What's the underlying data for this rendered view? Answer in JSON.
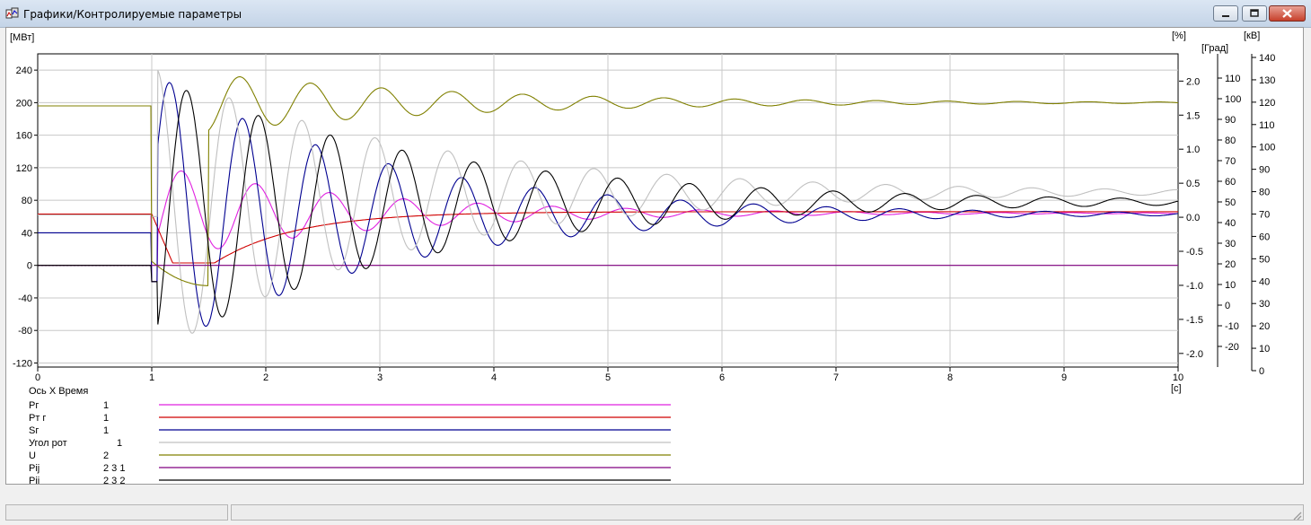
{
  "window": {
    "title": "Графики/Контролируемые параметры"
  },
  "chart_data": {
    "type": "line",
    "x": {
      "label": "[c]",
      "range": [
        0,
        10
      ],
      "ticks": [
        "0",
        "1",
        "2",
        "3",
        "4",
        "5",
        "6",
        "7",
        "8",
        "9",
        "10"
      ]
    },
    "axes": {
      "y_left": {
        "unit": "[МВт]",
        "range": [
          -125,
          260
        ],
        "ticks": [
          "240",
          "200",
          "160",
          "120",
          "80",
          "40",
          "0",
          "-40",
          "-80",
          "-120"
        ]
      },
      "y_right1": {
        "unit": "[%]",
        "range": [
          -2.2,
          2.4
        ],
        "ticks": [
          "2.0",
          "1.5",
          "1.0",
          "0.5",
          "0.0",
          "-0.5",
          "-1.0",
          "-1.5",
          "-2.0"
        ]
      },
      "y_right2": {
        "unit": "[Град]",
        "range": [
          -30,
          120
        ],
        "ticks": [
          "110",
          "100",
          "90",
          "80",
          "70",
          "60",
          "50",
          "40",
          "30",
          "20",
          "10",
          "0",
          "-10",
          "-20"
        ]
      },
      "y_right3": {
        "unit": "[кВ]",
        "range": [
          0,
          140
        ],
        "ticks": [
          "140",
          "130",
          "120",
          "110",
          "100",
          "90",
          "80",
          "70",
          "60",
          "50",
          "40",
          "30",
          "20",
          "10",
          "0"
        ]
      }
    },
    "grid": true,
    "zero_line": "dashed before t=1",
    "series": [
      {
        "name": "Pг",
        "axis": "y_left",
        "color": "#e020e0",
        "pre": 63,
        "post_start": -20,
        "final": 64,
        "amp": 60,
        "period": 0.65,
        "decay": 0.55,
        "phase": 0.1,
        "drift": 0
      },
      {
        "name": "Pт г",
        "axis": "y_left",
        "color": "#d00000",
        "pre": 63,
        "dip_to": 3,
        "dip_end": 1.55,
        "final": 66
      },
      {
        "name": "Sг",
        "axis": "y_left",
        "color": "#000090",
        "pre": 40,
        "post_start": -20,
        "final": 63,
        "amp": 175,
        "period": 0.64,
        "decay": 0.5,
        "phase": 0.0,
        "drift": 0
      },
      {
        "name": "Угол рот",
        "axis": "y_left",
        "color": "#c0c0c0",
        "pre": 62,
        "post_start": 60,
        "final": 90,
        "amp": 180,
        "period": 0.64,
        "decay": 0.45,
        "phase": -0.12,
        "drift": 25
      },
      {
        "name": "U",
        "axis": "y_left",
        "color": "#808000",
        "pre": 196,
        "dip_to": -25,
        "dip_end": 1.5,
        "final": 200,
        "amp": 45,
        "period": 0.62,
        "decay": 0.45
      },
      {
        "name": "Pij",
        "axis": "y_left",
        "color": "#800080",
        "pre": 0,
        "final": 0
      },
      {
        "name": "Pij",
        "axis": "y_left",
        "color": "#000000",
        "pre": 0,
        "post_start": -20,
        "final": 78,
        "amp": 170,
        "period": 0.63,
        "decay": 0.42,
        "phase": 0.15,
        "drift": 15
      }
    ]
  },
  "legend": {
    "header": "Ось X  Время",
    "items": [
      {
        "name": "Pг",
        "num": "1",
        "color": "#e020e0"
      },
      {
        "name": "Pт г",
        "num": "1",
        "color": "#d00000"
      },
      {
        "name": "Sг",
        "num": "1",
        "color": "#000090"
      },
      {
        "name": "Угол рот",
        "num": "1",
        "color": "#c0c0c0"
      },
      {
        "name": "U",
        "num": "2",
        "color": "#808000"
      },
      {
        "name": "Pij",
        "num": "2  3  1",
        "color": "#800080"
      },
      {
        "name": "Pij",
        "num": "2  3  2",
        "color": "#000000"
      }
    ]
  }
}
